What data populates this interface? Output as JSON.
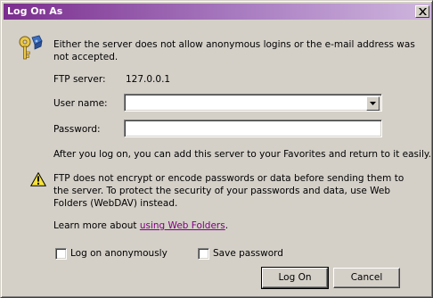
{
  "window": {
    "title": "Log On As"
  },
  "message": "Either the server does not allow anonymous logins or the e-mail address was not accepted.",
  "ftp_server": {
    "label": "FTP server:",
    "value": "127.0.0.1"
  },
  "user_name": {
    "label": "User name:",
    "value": ""
  },
  "password": {
    "label": "Password:",
    "value": ""
  },
  "after_logon_text": "After you log on, you can add this server to your Favorites and return to it easily.",
  "warning_text": "FTP does not encrypt or encode passwords or data before sending them to the server.  To protect the security of your passwords and data, use Web Folders (WebDAV) instead.",
  "learn_more": {
    "prefix": "Learn more about ",
    "link": "using Web Folders",
    "suffix": "."
  },
  "checkboxes": {
    "anonymous": {
      "label": "Log on anonymously",
      "checked": false
    },
    "save_password": {
      "label": "Save password",
      "checked": false
    }
  },
  "buttons": {
    "logon": "Log On",
    "cancel": "Cancel"
  },
  "icons": {
    "close": "close-icon",
    "keys": "keys-icon",
    "warning": "warning-icon",
    "dropdown": "chevron-down-icon"
  },
  "colors": {
    "title_start": "#7b2e8e",
    "title_end": "#cfb6de",
    "link": "#800080",
    "face": "#d4d0c8"
  }
}
